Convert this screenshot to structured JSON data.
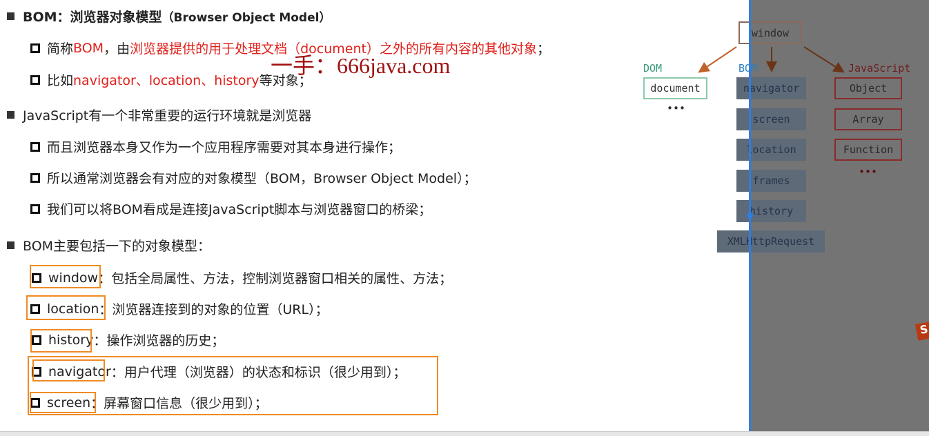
{
  "slide": {
    "heading": {
      "prefix": "BOM：",
      "title": "浏览器对象模型",
      "paren": "（Browser Object Model）"
    },
    "l1": {
      "a": "简称 ",
      "b": "BOM",
      "c": "，由",
      "d": "浏览器提供的用于处理文档（document）之外的所有内容的其他对象",
      "e": "；"
    },
    "l2": {
      "a": "比如",
      "b": "navigator、location、history",
      "c": "等对象；"
    },
    "l3": "JavaScript有一个非常重要的运行环境就是浏览器",
    "l4": "而且浏览器本身又作为一个应用程序需要对其本身进行操作；",
    "l5": "所以通常浏览器会有对应的对象模型（BOM，Browser Object Model）；",
    "l6": "我们可以将BOM看成是连接JavaScript脚本与浏览器窗口的桥梁；",
    "l7": "BOM主要包括一下的对象模型：",
    "items": [
      {
        "name": "window",
        "desc": "：包括全局属性、方法，控制浏览器窗口相关的属性、方法；"
      },
      {
        "name": "location",
        "desc": "：浏览器连接到的对象的位置（URL）；"
      },
      {
        "name": "history",
        "desc": "：操作浏览器的历史；"
      },
      {
        "name": "navigator",
        "desc": "：用户代理（浏览器）的状态和标识（很少用到）；"
      },
      {
        "name": "screen",
        "desc": "：屏幕窗口信息（很少用到）；"
      }
    ],
    "watermark": "一手：666java.com"
  },
  "diagram": {
    "root": "window",
    "dom_label": "DOM",
    "dom_items": [
      "document"
    ],
    "dom_more": "•••",
    "bom_label": "BOM",
    "bom_items": [
      "navigator",
      "screen",
      "location",
      "frames",
      "history",
      "XMLHttpRequest"
    ],
    "js_label": "JavaScript",
    "js_items": [
      "Object",
      "Array",
      "Function"
    ],
    "js_more": "•••"
  },
  "colors": {
    "red": "#e0201a",
    "orange": "#f08a24",
    "accent": "#2f7de1"
  }
}
